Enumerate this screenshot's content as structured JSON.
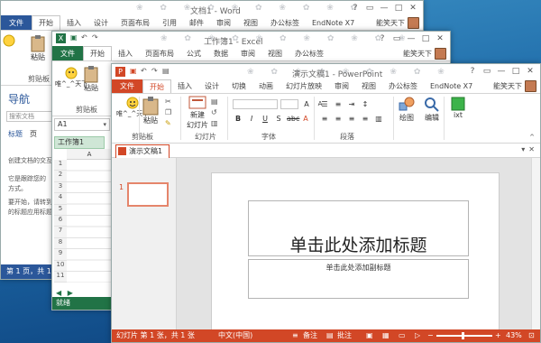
{
  "word": {
    "title": "文档1 - Word",
    "file_tab": "文件",
    "tabs": [
      "开始",
      "插入",
      "设计",
      "页面布局",
      "引用",
      "邮件",
      "审阅",
      "视图",
      "办公标签",
      "EndNote X7"
    ],
    "user": "能笑天下",
    "ribbon": {
      "paste": "粘贴",
      "clipboard": "剪贴板",
      "weiyu": "唯^_^天下"
    },
    "nav": {
      "title": "导航",
      "search_placeholder": "搜索文档",
      "tabs": [
        "标题",
        "页"
      ],
      "text_lines": [
        "创建文档的交互",
        "它是跟踪您的",
        "方式。",
        "要开始，请转到",
        "的标题应用标题"
      ]
    },
    "status": "第 1 页，共 1 页"
  },
  "excel": {
    "title": "工作簿1 - Excel",
    "file_tab": "文件",
    "tabs": [
      "开始",
      "插入",
      "页面布局",
      "公式",
      "数据",
      "审阅",
      "视图",
      "办公标签"
    ],
    "user": "能笑天下",
    "ribbon": {
      "paste": "粘贴",
      "clipboard": "剪贴板",
      "weiyu": "唯^_^天下"
    },
    "name_box": "A1",
    "workbook_tab": "工作簿1",
    "column_header": "A",
    "rows": [
      "1",
      "2",
      "3",
      "4",
      "5",
      "6",
      "7",
      "8",
      "9",
      "10",
      "11"
    ],
    "status": "就绪"
  },
  "ppt": {
    "title": "演示文稿1 - PowerPoint",
    "file_tab": "文件",
    "tabs": [
      "开始",
      "插入",
      "设计",
      "切换",
      "动画",
      "幻灯片放映",
      "审阅",
      "视图",
      "办公标签",
      "EndNote X7"
    ],
    "user": "能笑天下",
    "ribbon": {
      "weiyu": "唯^_^天下",
      "paste": "粘贴",
      "clipboard": "剪贴板",
      "new_slide": "新建\n幻灯片",
      "new_slide_line1": "新建",
      "new_slide_line2": "幻灯片",
      "slides_group": "幻灯片",
      "font_group": "字体",
      "paragraph_group": "段落",
      "drawing": "绘图",
      "editing": "编辑",
      "ixt": "ixt"
    },
    "doc_tab": "演示文稿1",
    "slide_number": "1",
    "slide_title": "单击此处添加标题",
    "slide_subtitle": "单击此处添加副标题",
    "status": {
      "slide_info": "幻灯片 第 1 张，共 1 张",
      "language": "中文(中国)",
      "notes": "备注",
      "comments": "批注",
      "zoom": "43%"
    }
  }
}
